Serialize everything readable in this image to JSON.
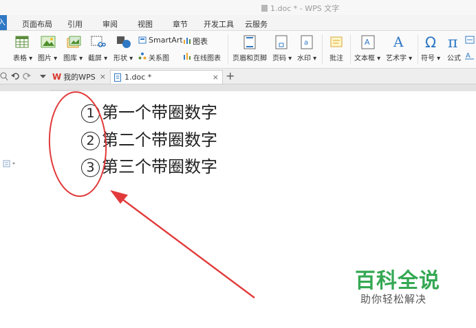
{
  "window": {
    "title": "1.doc * - WPS 文字"
  },
  "menu_tabs": [
    "入",
    "页面布局",
    "引用",
    "审阅",
    "视图",
    "章节",
    "开发工具",
    "云服务"
  ],
  "ribbon": {
    "table": "表格",
    "picture": "图片",
    "gallery": "图库",
    "screenshot": "截屏",
    "shape": "形状",
    "smartart": "SmartArt",
    "chart": "图表",
    "relation": "关系图",
    "online_chart": "在线图表",
    "header_footer": "页眉和页脚",
    "page_number": "页码",
    "watermark": "水印",
    "comment": "批注",
    "textbox": "文本框",
    "wordart": "艺术字",
    "symbol": "符号",
    "formula": "公式"
  },
  "tabs": {
    "home": "我的WPS",
    "doc": "1.doc *"
  },
  "document": {
    "lines": [
      {
        "num": "1",
        "text": "第一个带圈数字"
      },
      {
        "num": "2",
        "text": "第二个带圈数字"
      },
      {
        "num": "3",
        "text": "第三个带圈数字"
      }
    ]
  },
  "watermark": {
    "title": "百科全说",
    "subtitle": "助你轻松解决"
  },
  "colors": {
    "accent": "#2f78c4",
    "annotation": "#e23a3a",
    "watermark": "#34a853"
  }
}
